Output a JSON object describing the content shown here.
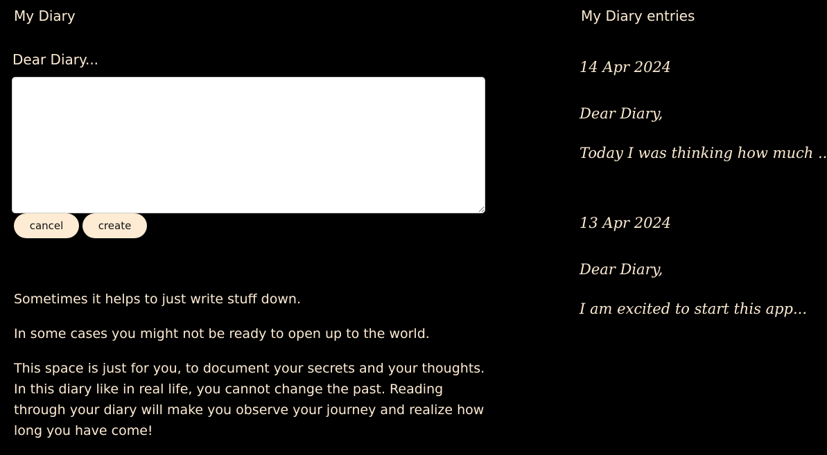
{
  "app": {
    "title": "My Diary"
  },
  "editor": {
    "label": "Dear Diary...",
    "textarea_value": "",
    "cancel_label": "cancel",
    "create_label": "create"
  },
  "intro": {
    "paragraphs": [
      "Sometimes it helps to just write stuff down.",
      "In some cases you might not be ready to open up to the world.",
      "This space is just for you, to document your secrets and your thoughts. In this diary like in real life, you cannot change the past. Reading through your diary will make you observe your journey and realize how long you have come!"
    ]
  },
  "entries": {
    "title": "My Diary entries",
    "items": [
      {
        "date": "14 Apr 2024",
        "greeting": "Dear Diary,",
        "preview": "Today I was thinking how much ..."
      },
      {
        "date": "13 Apr 2024",
        "greeting": "Dear Diary,",
        "preview": "I am excited to start this app..."
      }
    ]
  },
  "colors": {
    "background": "#000000",
    "text": "#fdebd3",
    "button_bg": "#fdebd3"
  }
}
